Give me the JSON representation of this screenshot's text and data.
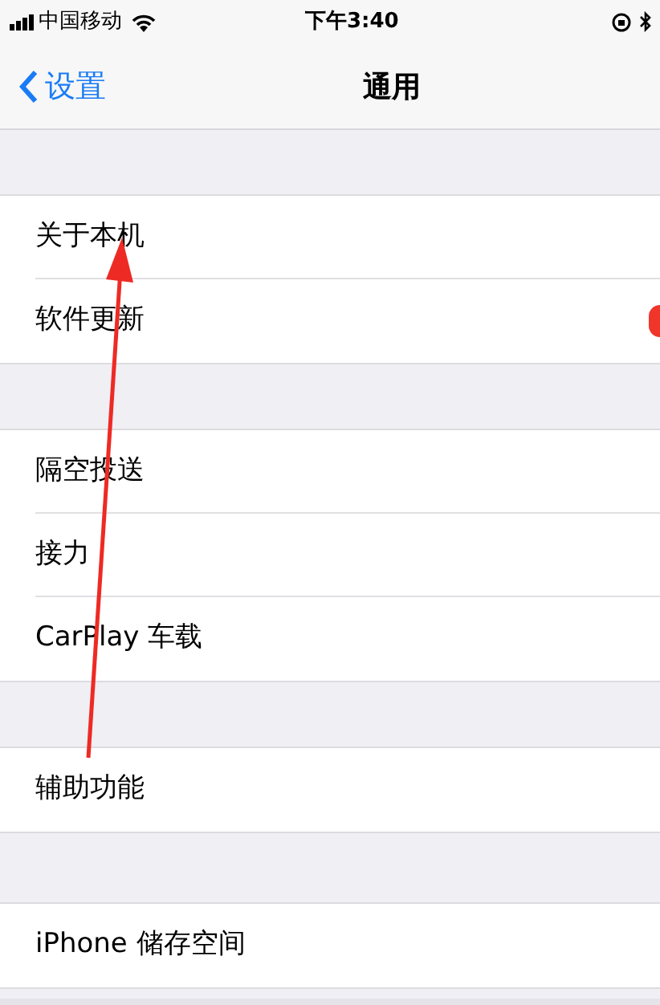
{
  "status_bar": {
    "carrier": "中国移动",
    "time": "下午3:40"
  },
  "nav_bar": {
    "back": "设置",
    "title": "通用"
  },
  "groups": [
    {
      "rows": [
        {
          "label": "关于本机",
          "badge": false
        },
        {
          "label": "软件更新",
          "badge": true
        }
      ]
    },
    {
      "rows": [
        {
          "label": "隔空投送",
          "badge": false
        },
        {
          "label": "接力",
          "badge": false
        },
        {
          "label": "CarPlay 车载",
          "badge": false
        }
      ]
    },
    {
      "rows": [
        {
          "label": "辅助功能",
          "badge": false
        }
      ]
    },
    {
      "rows": [
        {
          "label": "iPhone 储存空间",
          "badge": false
        }
      ]
    }
  ]
}
